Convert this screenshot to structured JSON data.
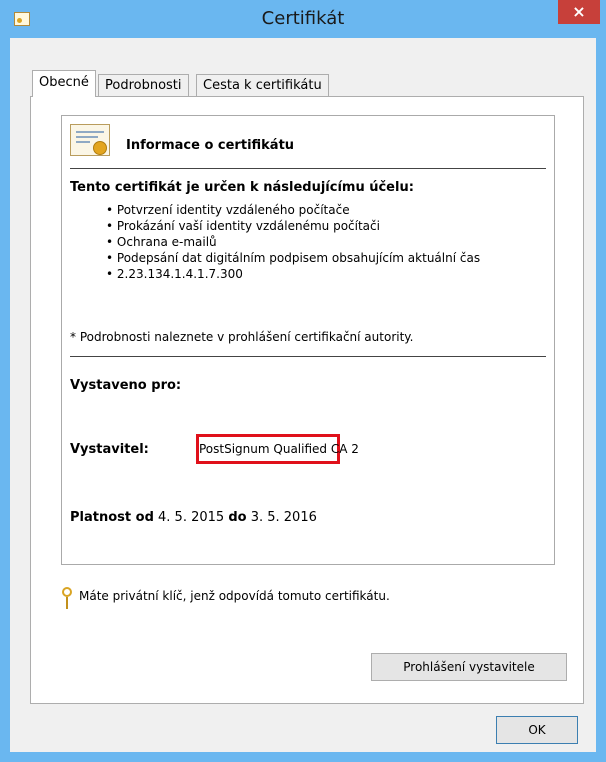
{
  "window": {
    "title": "Certifikát",
    "close_glyph": "×",
    "title_icon": "certificate-icon"
  },
  "tabs": [
    {
      "label": "Obecné",
      "active": true
    },
    {
      "label": "Podrobnosti",
      "active": false
    },
    {
      "label": "Cesta k certifikátu",
      "active": false
    }
  ],
  "info": {
    "heading": "Informace o certifikátu",
    "purpose_title": "Tento certifikát je určen k následujícímu účelu:",
    "purposes": [
      "Potvrzení identity vzdáleného počítače",
      "Prokázání vaší identity vzdálenému počítači",
      "Ochrana e-mailů",
      "Podepsání dat digitálním podpisem obsahujícím aktuální čas",
      "2.23.134.1.4.1.7.300"
    ],
    "note": "* Podrobnosti naleznete v prohlášení certifikační autority.",
    "issued_to_label": "Vystaveno pro:",
    "issuer_label": "Vystavitel:",
    "issuer_value": "PostSignum Qualified CA 2",
    "validity_from_label": "Platnost od",
    "validity_from": "4. 5. 2015",
    "validity_to_label": "do",
    "validity_to": "3. 5. 2016"
  },
  "key_message": "Máte privátní klíč, jenž odpovídá tomuto certifikátu.",
  "buttons": {
    "issuer_statement": "Prohlášení vystavitele",
    "ok": "OK"
  },
  "colors": {
    "titlebar": "#6ab7f0",
    "close": "#c7403a",
    "highlight": "#e0101a"
  }
}
